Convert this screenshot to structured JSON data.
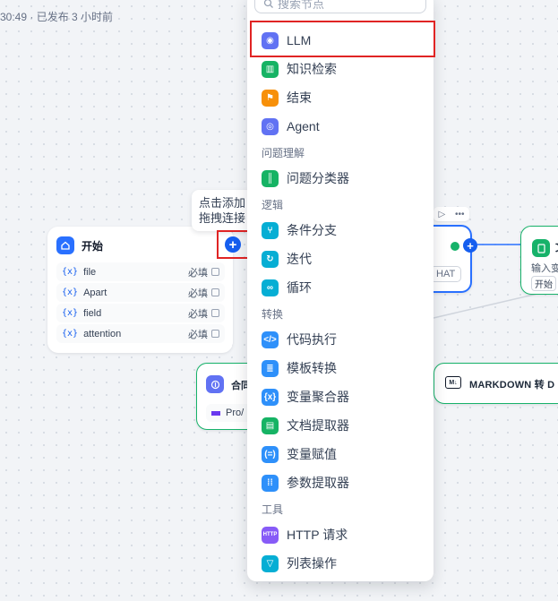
{
  "status_bar": "30:49 · 已发布 3 小时前",
  "canvas": {
    "start_node": {
      "title": "开始",
      "icon": "home-icon",
      "variables": [
        {
          "symbol": "{x}",
          "name": "file",
          "required": "必填"
        },
        {
          "symbol": "{x}",
          "name": "Apart",
          "required": "必填"
        },
        {
          "symbol": "{x}",
          "name": "field",
          "required": "必填"
        },
        {
          "symbol": "{x}",
          "name": "attention",
          "required": "必填"
        }
      ]
    },
    "tooltip": {
      "line1": "点击添加",
      "line2": "拖拽连接"
    },
    "llm_node_chip": "HAT",
    "doc_node": {
      "title": "文",
      "label": "输入变",
      "chip": "开始"
    },
    "markdown_node": {
      "title": "MARKDOWN 转 D",
      "icon_text": "M↓"
    },
    "merge_node": {
      "title": "合同",
      "chip": "Pro/"
    }
  },
  "node_panel": {
    "search_placeholder": "搜索节点",
    "items_top": [
      {
        "label": "LLM",
        "icon": "llm-icon",
        "color": "#6172f3"
      },
      {
        "label": "知识检索",
        "icon": "book-icon",
        "color": "#16b364"
      },
      {
        "label": "结束",
        "icon": "flag-icon",
        "color": "#f79009"
      },
      {
        "label": "Agent",
        "icon": "agent-icon",
        "color": "#6172f3"
      }
    ],
    "groups": [
      {
        "label": "问题理解",
        "items": [
          {
            "label": "问题分类器",
            "icon": "classifier-icon",
            "color": "#16b364"
          }
        ]
      },
      {
        "label": "逻辑",
        "items": [
          {
            "label": "条件分支",
            "icon": "branch-icon",
            "color": "#06aed4"
          },
          {
            "label": "迭代",
            "icon": "iterate-icon",
            "color": "#06aed4"
          },
          {
            "label": "循环",
            "icon": "loop-icon",
            "color": "#06aed4"
          }
        ]
      },
      {
        "label": "转换",
        "items": [
          {
            "label": "代码执行",
            "icon": "code-icon",
            "color": "#2e90fa"
          },
          {
            "label": "模板转换",
            "icon": "template-icon",
            "color": "#2e90fa"
          },
          {
            "label": "变量聚合器",
            "icon": "aggregator-icon",
            "color": "#2e90fa"
          },
          {
            "label": "文档提取器",
            "icon": "doc-extractor-icon",
            "color": "#16b364"
          },
          {
            "label": "变量赋值",
            "icon": "assign-icon",
            "color": "#2e90fa"
          },
          {
            "label": "参数提取器",
            "icon": "param-extractor-icon",
            "color": "#2e90fa"
          }
        ]
      },
      {
        "label": "工具",
        "items": [
          {
            "label": "HTTP 请求",
            "icon": "http-icon",
            "color": "#875bf7"
          },
          {
            "label": "列表操作",
            "icon": "list-filter-icon",
            "color": "#06aed4"
          }
        ]
      }
    ]
  }
}
